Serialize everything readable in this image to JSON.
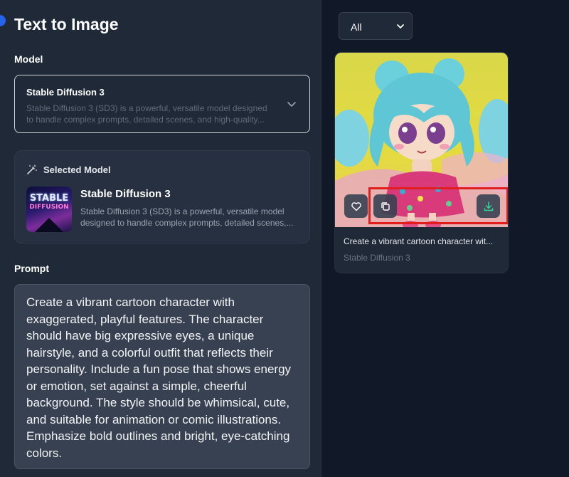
{
  "page": {
    "title": "Text to Image"
  },
  "model_section": {
    "label": "Model",
    "selected_name": "Stable Diffusion 3",
    "selected_desc": "Stable Diffusion 3 (SD3) is a powerful, versatile model designed to handle complex prompts, detailed scenes, and high-quality..."
  },
  "selected_model": {
    "header": "Selected Model",
    "thumb_line1": "STABLE",
    "thumb_line2": "DIFFUSION",
    "name": "Stable Diffusion 3",
    "desc": "Stable Diffusion 3 (SD3) is a powerful, versatile model designed to handle complex prompts, detailed scenes,..."
  },
  "prompt_section": {
    "label": "Prompt",
    "text": "Create a vibrant cartoon character with exaggerated, playful features. The character should have big expressive eyes, a unique hairstyle, and a colorful outfit that reflects their personality. Include a fun pose that shows energy or emotion, set against a simple, cheerful background. The style should be whimsical, cute, and suitable for animation or comic illustrations. Emphasize bold outlines and bright, eye-catching colors."
  },
  "filter": {
    "value": "All"
  },
  "image_card": {
    "caption": "Create a vibrant cartoon character wit...",
    "model": "Stable Diffusion 3",
    "actions": {
      "favorite": "heart-icon",
      "copy": "copy-icon",
      "download": "download-icon"
    }
  },
  "colors": {
    "accent": "#2563eb",
    "highlight": "#e11d1d",
    "download_icon": "#34d399"
  }
}
